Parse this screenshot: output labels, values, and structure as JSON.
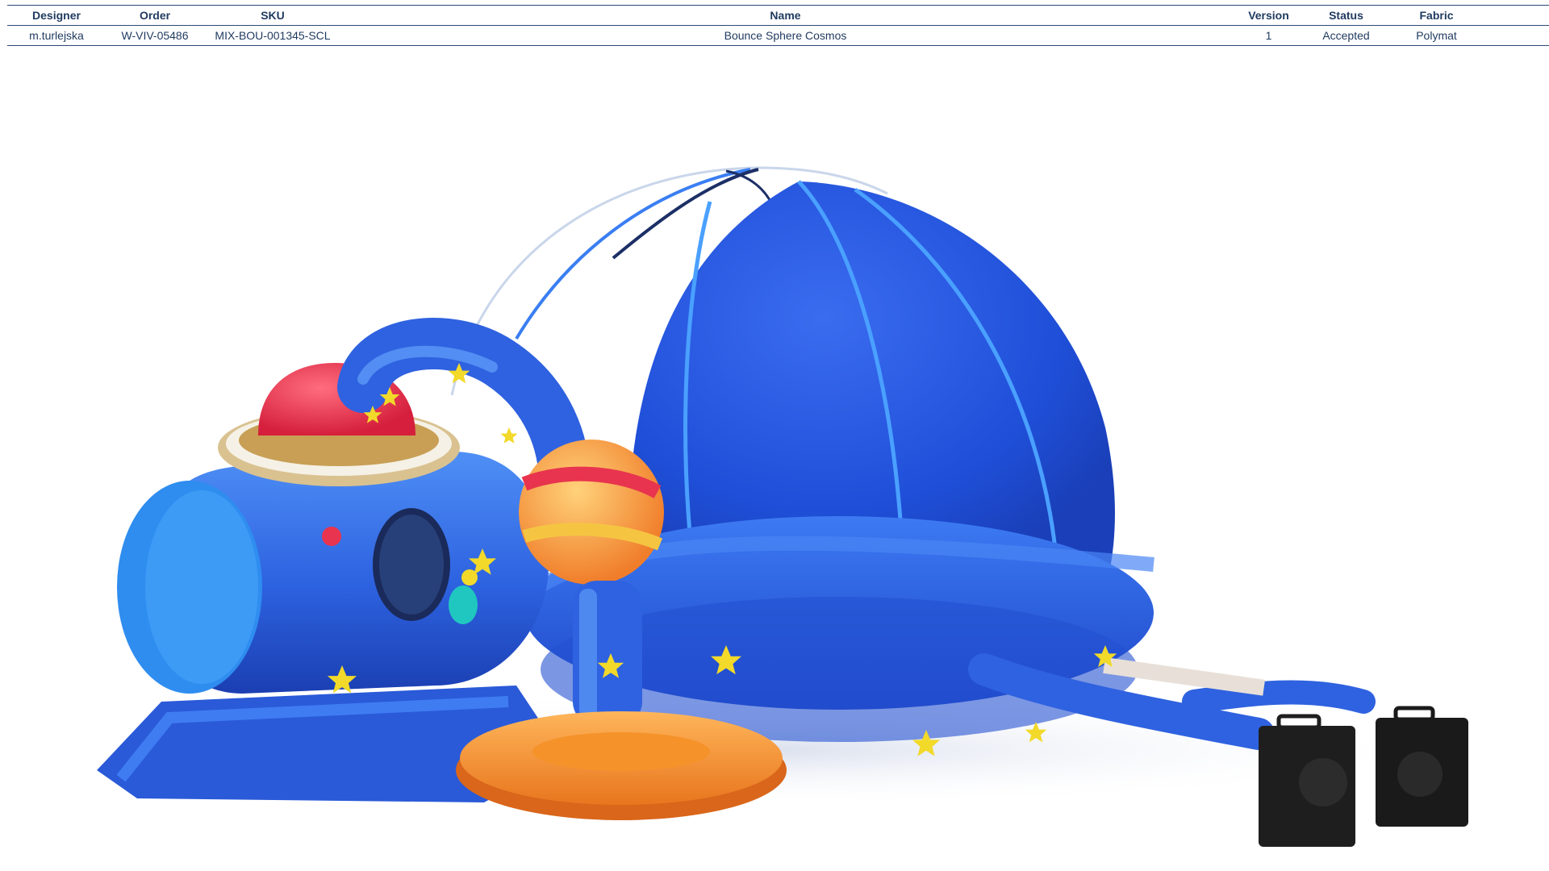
{
  "table": {
    "headers": {
      "designer": "Designer",
      "order": "Order",
      "sku": "SKU",
      "name": "Name",
      "version": "Version",
      "status": "Status",
      "fabric": "Fabric"
    },
    "row": {
      "designer": "m.turlejska",
      "order": "W-VIV-05486",
      "sku": "MIX-BOU-001345-SCL",
      "name": "Bounce Sphere Cosmos",
      "version": "1",
      "status": "Accepted",
      "fabric": "Polymat"
    }
  },
  "colors": {
    "header_text": "#1f3a5f",
    "rule": "#2c4a73",
    "inflatable_blue": "#2f5fe0",
    "dome_blue": "#1f4fd8",
    "orange_ring": "#f5922a",
    "red_dome": "#e8344e",
    "star_yellow": "#f2d92a",
    "blower_black": "#222222"
  }
}
